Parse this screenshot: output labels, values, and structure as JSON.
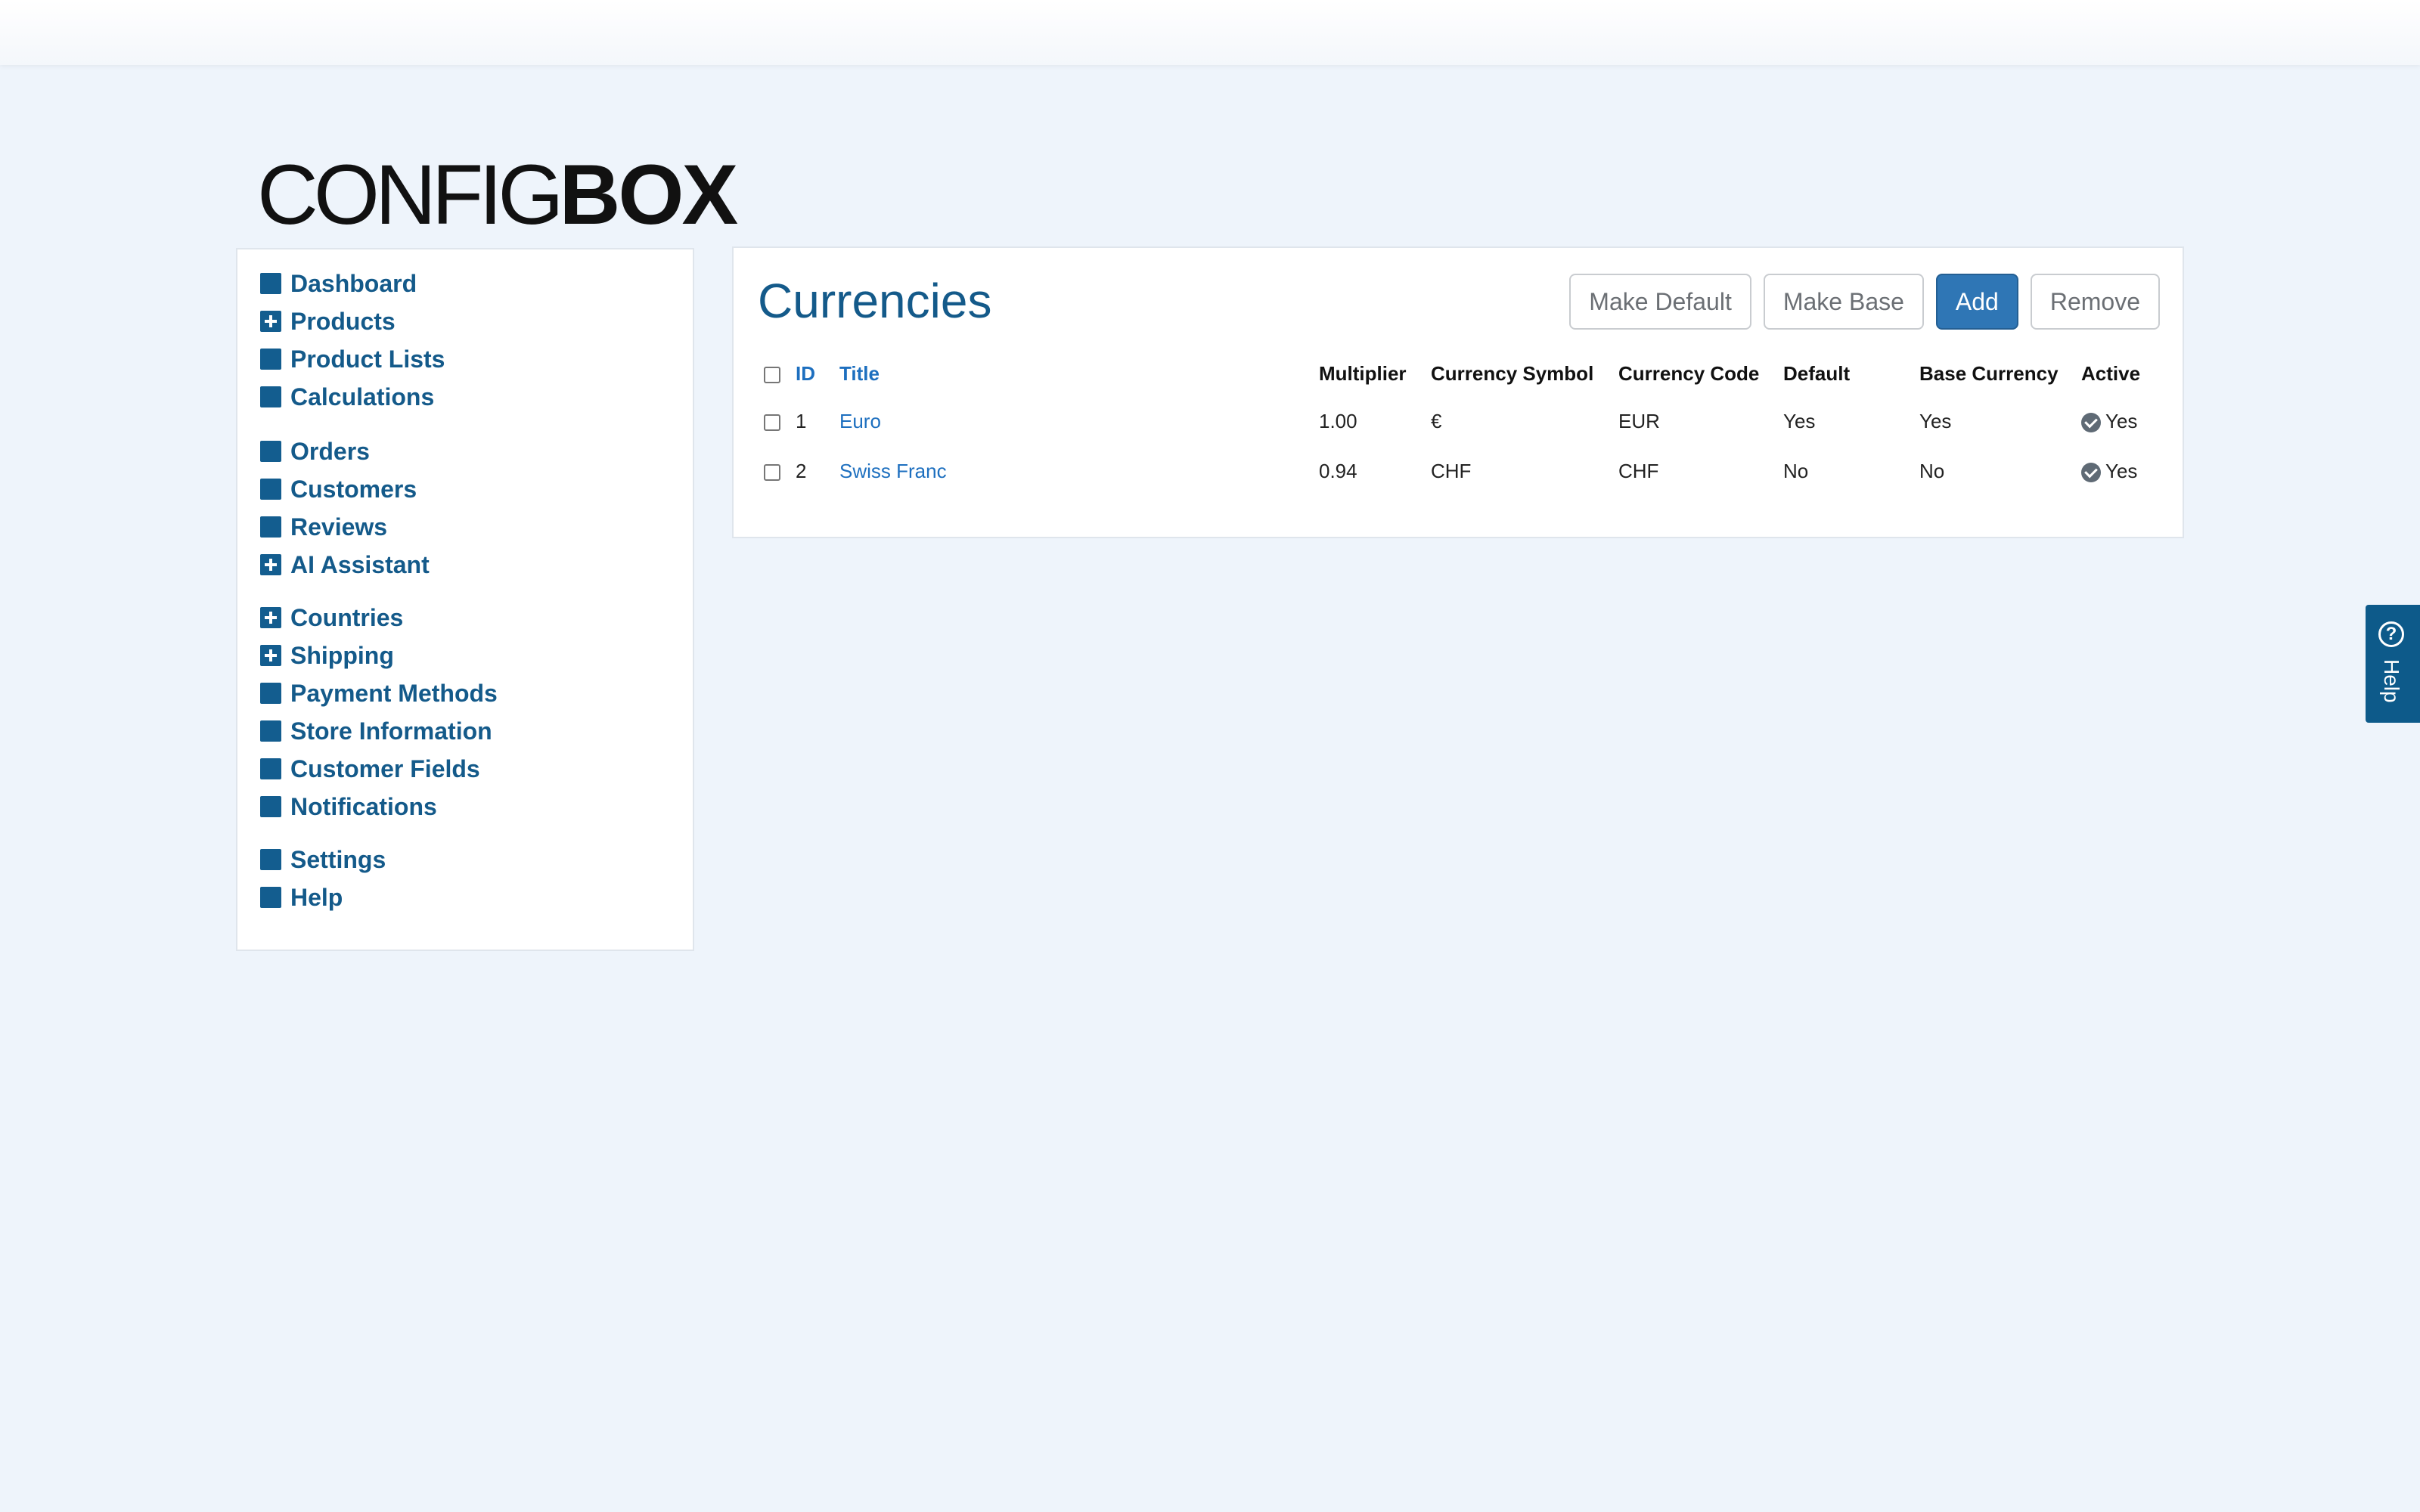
{
  "logo": {
    "part_light": "CONFIG",
    "part_bold": "BOX"
  },
  "sidebar": {
    "groups": [
      [
        {
          "label": "Dashboard",
          "icon": "square-icon"
        },
        {
          "label": "Products",
          "icon": "plus-square-icon"
        },
        {
          "label": "Product Lists",
          "icon": "square-icon"
        },
        {
          "label": "Calculations",
          "icon": "square-icon"
        }
      ],
      [
        {
          "label": "Orders",
          "icon": "square-icon"
        },
        {
          "label": "Customers",
          "icon": "square-icon"
        },
        {
          "label": "Reviews",
          "icon": "square-icon"
        },
        {
          "label": "AI Assistant",
          "icon": "plus-square-icon"
        }
      ],
      [
        {
          "label": "Countries",
          "icon": "plus-square-icon"
        },
        {
          "label": "Shipping",
          "icon": "plus-square-icon"
        },
        {
          "label": "Payment Methods",
          "icon": "square-icon"
        },
        {
          "label": "Store Information",
          "icon": "square-icon"
        },
        {
          "label": "Customer Fields",
          "icon": "square-icon"
        },
        {
          "label": "Notifications",
          "icon": "square-icon"
        }
      ],
      [
        {
          "label": "Settings",
          "icon": "square-icon"
        },
        {
          "label": "Help",
          "icon": "square-icon"
        }
      ]
    ]
  },
  "main": {
    "title": "Currencies",
    "toolbar": {
      "make_default": "Make Default",
      "make_base": "Make Base",
      "add": "Add",
      "remove": "Remove"
    },
    "table": {
      "columns": {
        "id": "ID",
        "title": "Title",
        "multiplier": "Multiplier",
        "symbol": "Currency Symbol",
        "code": "Currency Code",
        "default": "Default",
        "base": "Base Currency",
        "active": "Active"
      },
      "rows": [
        {
          "id": "1",
          "title": "Euro",
          "multiplier": "1.00",
          "symbol": "€",
          "code": "EUR",
          "default": "Yes",
          "base": "Yes",
          "active": "Yes"
        },
        {
          "id": "2",
          "title": "Swiss Franc",
          "multiplier": "0.94",
          "symbol": "CHF",
          "code": "CHF",
          "default": "No",
          "base": "No",
          "active": "Yes"
        }
      ]
    }
  },
  "help_tab": {
    "label": "Help"
  },
  "colors": {
    "brand": "#145a8a",
    "link": "#1d6fbf",
    "primary_button": "#2f76b5",
    "background": "#eef4fb"
  }
}
